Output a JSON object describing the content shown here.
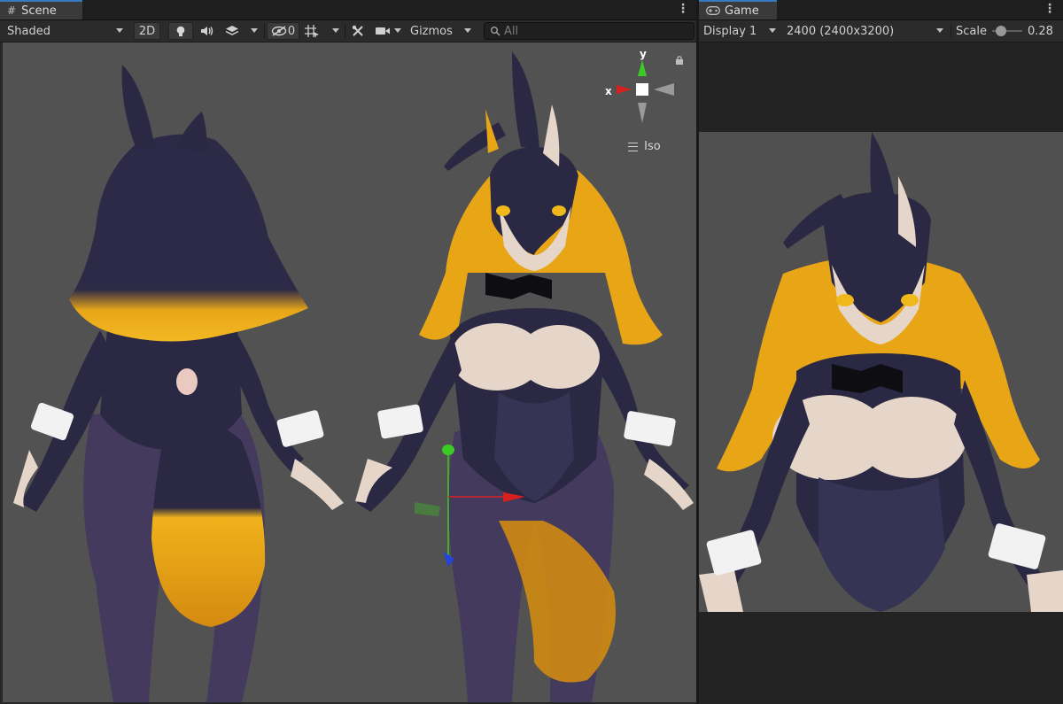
{
  "scene": {
    "tab_label": "Scene",
    "tab_icon": "#",
    "menu_icon": "⋮",
    "shading_mode": "Shaded",
    "mode_2d": "2D",
    "hidden_count": "0",
    "gizmos_label": "Gizmos",
    "search_placeholder": "All",
    "gizmo": {
      "x_label": "x",
      "y_label": "y",
      "projection": "Iso"
    }
  },
  "game": {
    "tab_label": "Game",
    "menu_icon": "⋮",
    "display": "Display 1",
    "resolution": "2400 (2400x3200)",
    "scale_label": "Scale",
    "scale_value": "0.28",
    "scale_fraction": 0.28
  },
  "colors": {
    "accent": "#3a79bb",
    "viewport": "#525252",
    "fur_dark": "#2a2843",
    "hair_orange": "#e8a617",
    "skin": "#e6d6c9",
    "axis_x": "#d62020",
    "axis_y": "#3ccb25",
    "axis_z": "#2244dd"
  }
}
